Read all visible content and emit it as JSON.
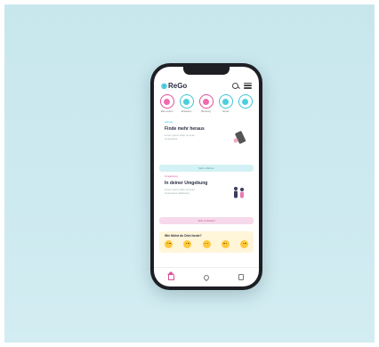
{
  "app": {
    "name": "ReGo"
  },
  "categories": [
    {
      "label": "Mein Leben",
      "color": "pink"
    },
    {
      "label": "Einkaufen",
      "color": "teal"
    },
    {
      "label": "Beratung",
      "color": "pink"
    },
    {
      "label": "Sozial",
      "color": "teal"
    },
    {
      "label": "",
      "color": "teal"
    }
  ],
  "card1": {
    "tag": "Aktuell",
    "title": "Finde mehr heraus",
    "text": "Lorem ipsum dolor sit amet consectetur",
    "button": "Mehr erfahren"
  },
  "card2": {
    "tag": "Umgebung",
    "title": "In deiner Umgebung",
    "text": "Lorem ipsum dolor sit amet consectetur adipiscing",
    "button": "Jetzt entdecken"
  },
  "mood": {
    "question": "Wie fühlst du Dich heute?"
  },
  "tabbar": [
    "home",
    "map",
    "notes"
  ]
}
